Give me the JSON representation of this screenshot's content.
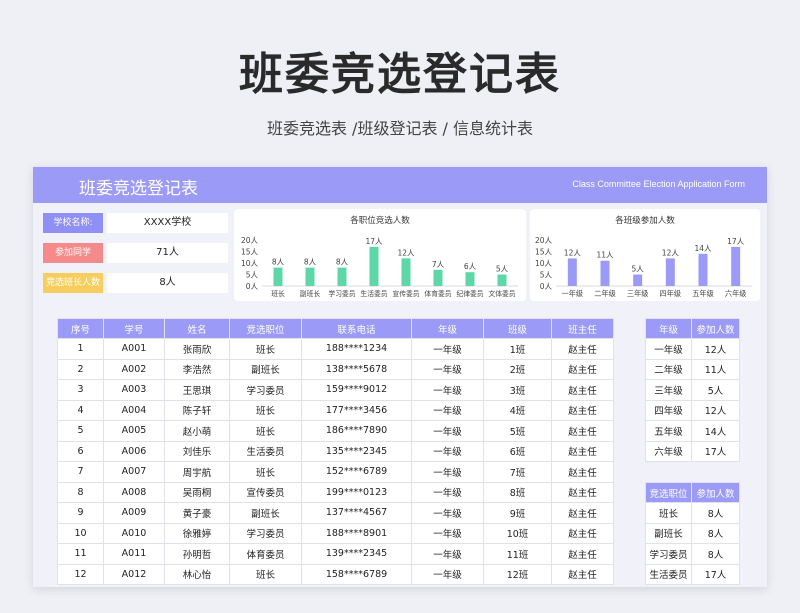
{
  "hero": {
    "title": "班委竞选登记表",
    "subtitle": "班委竞选表 /班级登记表 / 信息统计表"
  },
  "banner": {
    "title": "班委竞选登记表",
    "subtitle_en": "Class Committee Election Application Form"
  },
  "info": [
    {
      "label": "学校名称:",
      "value": "XXXX学校",
      "color": "#8f8ff5"
    },
    {
      "label": "参加同学",
      "value": "71人",
      "color": "#f48a8a"
    },
    {
      "label": "竞选班长人数",
      "value": "8人",
      "color": "#f7ce5e"
    }
  ],
  "chart_data": [
    {
      "type": "bar",
      "title": "各职位竞选人数",
      "categories": [
        "班长",
        "副班长",
        "学习委员",
        "生活委员",
        "宣传委员",
        "体育委员",
        "纪律委员",
        "文体委员"
      ],
      "values": [
        8,
        8,
        8,
        17,
        12,
        7,
        6,
        5
      ],
      "data_labels": [
        "8人",
        "8人",
        "8人",
        "17人",
        "12人",
        "7人",
        "6人",
        "5人"
      ],
      "yticks": [
        "0人",
        "5人",
        "10人",
        "15人",
        "20人"
      ],
      "ylim": [
        0,
        20
      ],
      "color": "#5dd6a8",
      "grid": false
    },
    {
      "type": "bar",
      "title": "各班级参加人数",
      "categories": [
        "一年级",
        "二年级",
        "三年级",
        "四年级",
        "五年级",
        "六年级"
      ],
      "values": [
        12,
        11,
        5,
        12,
        14,
        17
      ],
      "data_labels": [
        "12人",
        "11人",
        "5人",
        "12人",
        "14人",
        "17人"
      ],
      "yticks": [
        "0人",
        "5人",
        "10人",
        "15人",
        "20人"
      ],
      "ylim": [
        0,
        20
      ],
      "color": "#9b9bf7",
      "grid": false
    }
  ],
  "main_table": {
    "headers": [
      "序号",
      "学号",
      "姓名",
      "竞选职位",
      "联系电话",
      "年级",
      "班级",
      "班主任"
    ],
    "rows": [
      [
        "1",
        "A001",
        "张雨欣",
        "班长",
        "188****1234",
        "一年级",
        "1班",
        "赵主任"
      ],
      [
        "2",
        "A002",
        "李浩然",
        "副班长",
        "138****5678",
        "一年级",
        "2班",
        "赵主任"
      ],
      [
        "3",
        "A003",
        "王思琪",
        "学习委员",
        "159****9012",
        "一年级",
        "3班",
        "赵主任"
      ],
      [
        "4",
        "A004",
        "陈子轩",
        "班长",
        "177****3456",
        "一年级",
        "4班",
        "赵主任"
      ],
      [
        "5",
        "A005",
        "赵小萌",
        "班长",
        "186****7890",
        "一年级",
        "5班",
        "赵主任"
      ],
      [
        "6",
        "A006",
        "刘佳乐",
        "生活委员",
        "135****2345",
        "一年级",
        "6班",
        "赵主任"
      ],
      [
        "7",
        "A007",
        "周宇航",
        "班长",
        "152****6789",
        "一年级",
        "7班",
        "赵主任"
      ],
      [
        "8",
        "A008",
        "吴雨桐",
        "宣传委员",
        "199****0123",
        "一年级",
        "8班",
        "赵主任"
      ],
      [
        "9",
        "A009",
        "黄子豪",
        "副班长",
        "137****4567",
        "一年级",
        "9班",
        "赵主任"
      ],
      [
        "10",
        "A010",
        "徐雅婷",
        "学习委员",
        "188****8901",
        "一年级",
        "10班",
        "赵主任"
      ],
      [
        "11",
        "A011",
        "孙明哲",
        "体育委员",
        "139****2345",
        "一年级",
        "11班",
        "赵主任"
      ],
      [
        "12",
        "A012",
        "林心怡",
        "班长",
        "158****6789",
        "一年级",
        "12班",
        "赵主任"
      ]
    ]
  },
  "grade_table": {
    "headers": [
      "年级",
      "参加人数"
    ],
    "rows": [
      [
        "一年级",
        "12人"
      ],
      [
        "二年级",
        "11人"
      ],
      [
        "三年级",
        "5人"
      ],
      [
        "四年级",
        "12人"
      ],
      [
        "五年级",
        "14人"
      ],
      [
        "六年级",
        "17人"
      ]
    ]
  },
  "position_table": {
    "headers": [
      "竞选职位",
      "参加人数"
    ],
    "rows": [
      [
        "班长",
        "8人"
      ],
      [
        "副班长",
        "8人"
      ],
      [
        "学习委员",
        "8人"
      ],
      [
        "生活委员",
        "17人"
      ]
    ]
  }
}
